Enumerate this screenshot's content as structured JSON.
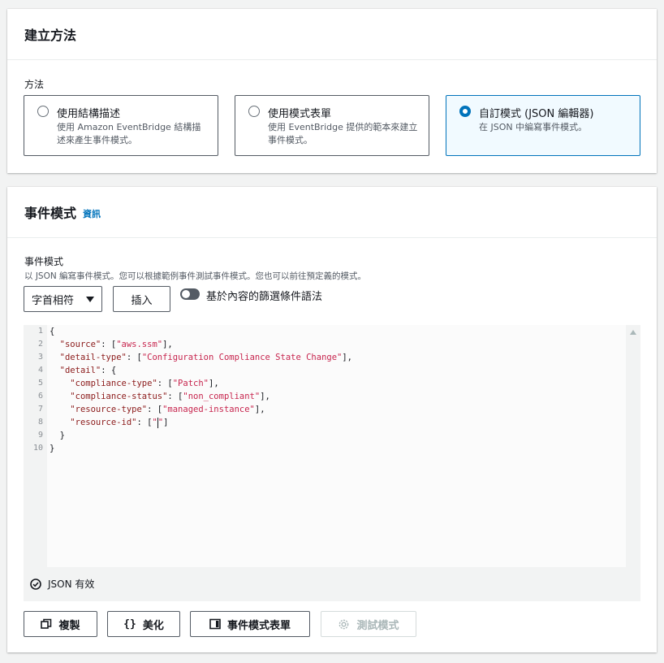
{
  "method_card": {
    "title": "建立方法",
    "label": "方法",
    "options": [
      {
        "title": "使用結構描述",
        "desc": "使用 Amazon EventBridge 結構描述來產生事件模式。",
        "selected": false
      },
      {
        "title": "使用模式表單",
        "desc": "使用 EventBridge 提供的範本來建立事件模式。",
        "selected": false
      },
      {
        "title": "自訂模式 (JSON 編輯器)",
        "desc": "在 JSON 中編寫事件模式。",
        "selected": true
      }
    ]
  },
  "pattern_card": {
    "title": "事件模式",
    "info_link": "資訊",
    "field_label": "事件模式",
    "field_desc": "以 JSON 編寫事件模式。您可以根據範例事件測試事件模式。您也可以前往預定義的模式。",
    "select_value": "字首相符",
    "insert_label": "插入",
    "toggle_label": "基於內容的篩選條件語法",
    "line_numbers": [
      "1",
      "2",
      "3",
      "4",
      "5",
      "6",
      "7",
      "8",
      "9",
      "10"
    ],
    "code": {
      "l1": "{",
      "l2_key": "\"source\"",
      "l2_val": "\"aws.ssm\"",
      "l3_key": "\"detail-type\"",
      "l3_val": "\"Configuration Compliance State Change\"",
      "l4_key": "\"detail\"",
      "l5_key": "\"compliance-type\"",
      "l5_val": "\"Patch\"",
      "l6_key": "\"compliance-status\"",
      "l6_val": "\"non_compliant\"",
      "l7_key": "\"resource-type\"",
      "l7_val": "\"managed-instance\"",
      "l8_key": "\"resource-id\"",
      "l8_val_a": "\"",
      "l8_val_b": "\"",
      "l9": "}",
      "l10": "}"
    },
    "status_text": "JSON 有效",
    "buttons": {
      "copy": "複製",
      "prettify": "美化",
      "form": "事件模式表單",
      "test": "測試模式"
    }
  }
}
